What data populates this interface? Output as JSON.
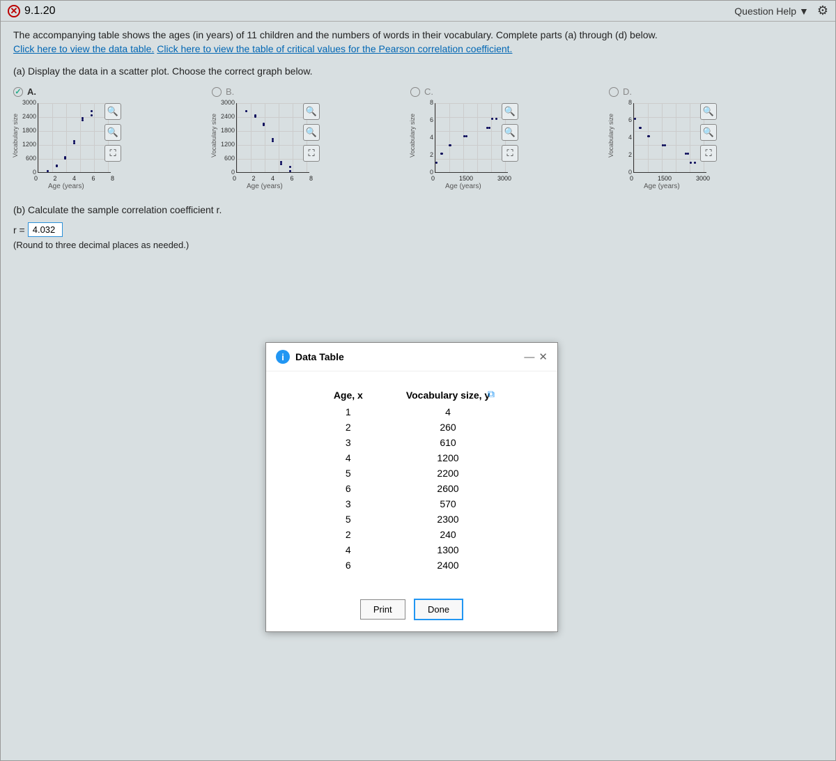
{
  "header": {
    "question_num": "9.1.20",
    "help_label": "Question Help"
  },
  "intro": {
    "line1_a": "The accompanying table shows the ages (in years) of 11 children and the numbers of words in their vocabulary. Complete parts (a) through (d) below.",
    "link1": "Click here to view the data table.",
    "link2": "Click here to view the table of critical values for the Pearson correlation coefficient."
  },
  "part_a": "(a) Display the data in a scatter plot. Choose the correct graph below.",
  "options": {
    "a": "A.",
    "b": "B.",
    "c": "C.",
    "d": "D."
  },
  "chart_labels": {
    "y": "Vocabulary size",
    "x": "Age (years)",
    "ab_yticks": [
      "3000",
      "2400",
      "1800",
      "1200",
      "600",
      "0"
    ],
    "ab_xticks": [
      "0",
      "2",
      "4",
      "6",
      "8"
    ],
    "cd_yticks": [
      "8",
      "6",
      "4",
      "2",
      "0"
    ],
    "cd_xticks": [
      "0",
      "1500",
      "3000"
    ]
  },
  "part_b": "(b) Calculate the sample correlation coefficient r.",
  "r_prefix": "r =",
  "r_value": "4.032",
  "round_note": "(Round to three decimal places as needed.)",
  "modal": {
    "title": "Data Table",
    "col1": "Age, x",
    "col2": "Vocabulary size, y",
    "print": "Print",
    "done": "Done"
  },
  "chart_data": {
    "type": "table",
    "columns": [
      "Age, x",
      "Vocabulary size, y"
    ],
    "rows": [
      [
        1,
        4
      ],
      [
        2,
        260
      ],
      [
        3,
        610
      ],
      [
        4,
        1200
      ],
      [
        5,
        2200
      ],
      [
        6,
        2600
      ],
      [
        3,
        570
      ],
      [
        5,
        2300
      ],
      [
        2,
        240
      ],
      [
        4,
        1300
      ],
      [
        6,
        2400
      ]
    ]
  }
}
